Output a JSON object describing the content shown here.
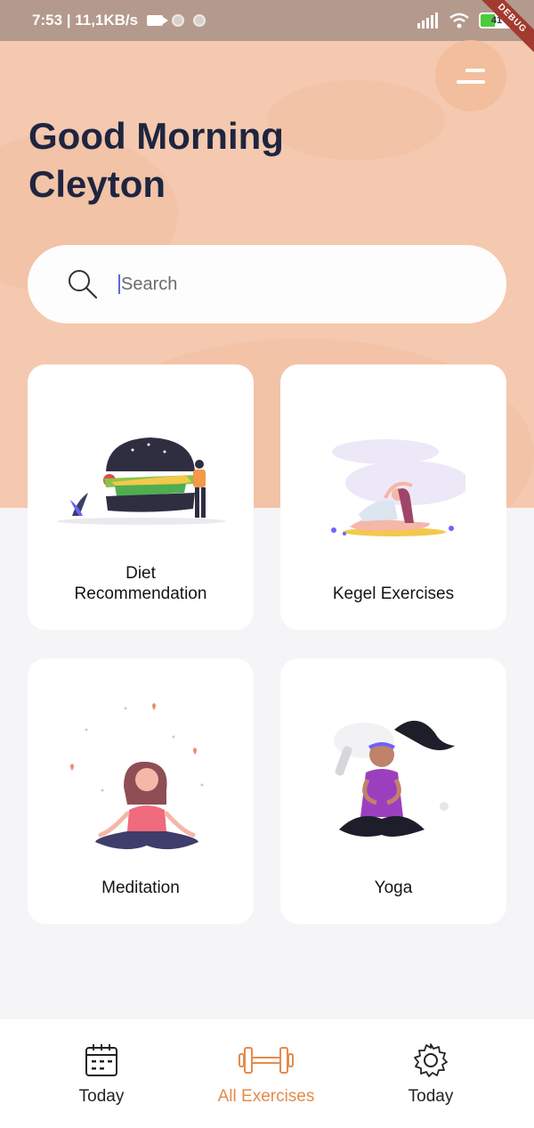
{
  "status_bar": {
    "time_speed": "7:53 | 11,1KB/s",
    "battery": "41",
    "debug_label": "DEBUG"
  },
  "header": {
    "greeting_line1": "Good Morning",
    "greeting_line2": "Cleyton",
    "menu_icon": "menu-icon"
  },
  "search": {
    "placeholder": "Search",
    "value": "",
    "icon": "search-icon"
  },
  "cards": [
    {
      "label_line1": "Diet",
      "label_line2": "Recommendation",
      "illustration": "burger-illustration"
    },
    {
      "label_line1": "Kegel Exercises",
      "illustration": "stretching-illustration"
    },
    {
      "label_line1": "Meditation",
      "illustration": "meditation-illustration"
    },
    {
      "label_line1": "Yoga",
      "illustration": "yoga-illustration"
    }
  ],
  "bottom_nav": {
    "items": [
      {
        "label": "Today",
        "icon": "calendar-icon",
        "active": false
      },
      {
        "label": "All Exercises",
        "icon": "dumbbell-icon",
        "active": true
      },
      {
        "label": "Today",
        "icon": "gear-icon",
        "active": false
      }
    ]
  },
  "colors": {
    "hero_background": "#F4C9AF",
    "accent": "#E68A4A",
    "heading": "#1F2540",
    "page_background": "#F5F4F7"
  }
}
